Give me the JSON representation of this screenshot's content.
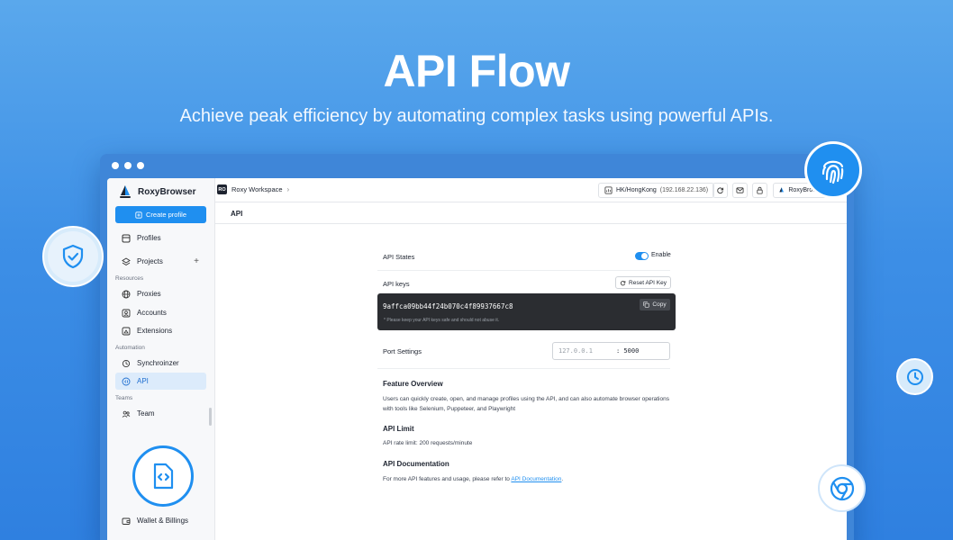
{
  "hero": {
    "title": "API Flow",
    "subtitle": "Achieve peak efficiency by automating complex tasks using powerful APIs."
  },
  "sidebar": {
    "brand": "RoxyBrowser",
    "create_button": "Create profile",
    "items": {
      "profiles": "Profiles",
      "projects": "Projects",
      "proxies": "Proxies",
      "accounts": "Accounts",
      "extensions": "Extensions",
      "synchronizer": "Synchroinzer",
      "api": "API",
      "team": "Team",
      "wallet": "Wallet & Billings"
    },
    "sections": {
      "resources": "Resources",
      "automation": "Automation",
      "teams": "Teams"
    }
  },
  "topbar": {
    "workspace_badge": "RO",
    "workspace": "Roxy Workspace",
    "proxy_location": "HK/HongKong",
    "proxy_ip": "(192.168.22.136)",
    "user": "RoxyBrowser"
  },
  "page": {
    "title": "API",
    "api_states_label": "API States",
    "enable_label": "Enable",
    "api_keys_label": "API keys",
    "reset_button": "Reset API Key",
    "api_key": "9affca09bb44f24b070c4f89937667c8",
    "copy_button": "Copy",
    "key_note": "* Please keep your API keys safe and should not abuse it.",
    "port_label": "Port Settings",
    "port_ip": "127.0.0.1",
    "port_value": ": 5000",
    "feature_title": "Feature Overview",
    "feature_text": "Users can quickly create, open, and manage profiles using the API, and can also automate browser operations with tools like Selenium, Puppeteer, and Playwright",
    "limit_title": "API Limit",
    "limit_text": "API rate limit: 200 requests/minute",
    "docs_title": "API Documentation",
    "docs_text": "For more API features and usage, please refer to",
    "docs_link": "API Documentation",
    "docs_end": "."
  },
  "colors": {
    "accent": "#1f8ff0",
    "background": "#3d8fe6",
    "key_box": "#2b2d31"
  },
  "icons": [
    "shield-check-icon",
    "fingerprint-icon",
    "clock-icon",
    "chrome-icon",
    "code-file-icon"
  ]
}
